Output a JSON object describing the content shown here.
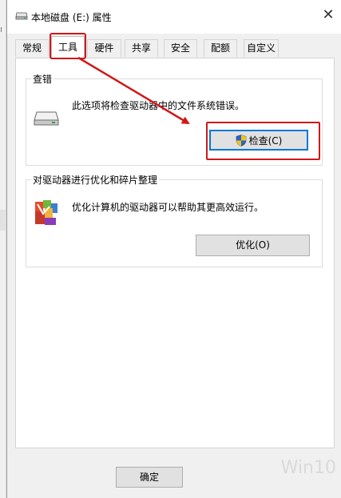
{
  "window": {
    "title": "本地磁盘 (E:) 属性",
    "close_glyph": "✕"
  },
  "tabs": [
    {
      "label": "常规",
      "active": false
    },
    {
      "label": "工具",
      "active": true
    },
    {
      "label": "硬件",
      "active": false
    },
    {
      "label": "共享",
      "active": false
    },
    {
      "label": "安全",
      "active": false
    },
    {
      "label": "配额",
      "active": false
    },
    {
      "label": "自定义",
      "active": false
    }
  ],
  "error_check": {
    "group_label": "查错",
    "description": "此选项将检查驱动器中的文件系统错误。",
    "icon": "drive-icon",
    "button_label": "检查(C)",
    "button_icon": "uac-shield-icon"
  },
  "optimize": {
    "group_label": "对驱动器进行优化和碎片整理",
    "description": "优化计算机的驱动器可以帮助其更高效运行。",
    "icon": "defrag-icon",
    "button_label": "优化(O)"
  },
  "footer": {
    "ok_label": "确定"
  },
  "watermark": {
    "text": "Win10"
  },
  "colors": {
    "annotation_red": "#d01818",
    "focus_blue": "#0078d7"
  }
}
